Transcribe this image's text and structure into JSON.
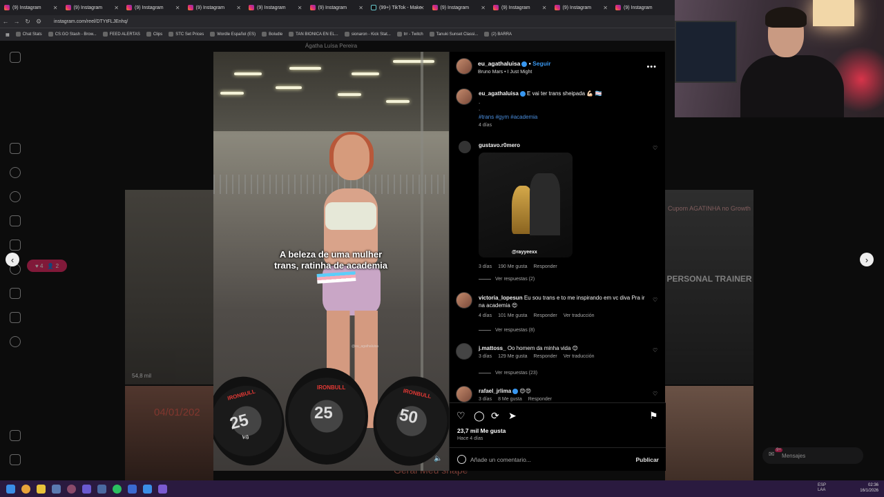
{
  "browser": {
    "tabs": [
      {
        "label": "(9) Instagram",
        "kind": "ig"
      },
      {
        "label": "(9) Instagram",
        "kind": "ig"
      },
      {
        "label": "(9) Instagram",
        "kind": "ig"
      },
      {
        "label": "(9) Instagram",
        "kind": "ig"
      },
      {
        "label": "(9) Instagram",
        "kind": "ig"
      },
      {
        "label": "(9) Instagram",
        "kind": "ig"
      },
      {
        "label": "(99+) TikTok - Make",
        "kind": "tt"
      },
      {
        "label": "(9) Instagram",
        "kind": "ig"
      },
      {
        "label": "(9) Instagram",
        "kind": "ig"
      },
      {
        "label": "(9) Instagram",
        "kind": "ig"
      },
      {
        "label": "(9) Instagram",
        "kind": "ig"
      }
    ],
    "url": "instagram.com/reel/DTYtFLJEnhq/",
    "bookmarks": [
      "Chat Stats",
      "CS:GO Stash - Brow...",
      "FEED ALERTAS",
      "Clips",
      "STC Set Prices",
      "Wordle Español (ES)",
      "Boludle",
      "TAN BIONICA EN EL...",
      "sionaron - Kick Stat...",
      "trr - Twitch",
      "Tanuki Sunset Classi...",
      "(2) BARRA"
    ]
  },
  "video": {
    "top_label": "Ágatha Luísa Pereira",
    "caption_line1": "A beleza de uma mulher",
    "caption_line2": "trans, ratinha de academia",
    "watermark": "@eu_agathaluisa",
    "weight_brand": "IRONBULL",
    "weight_1": "25",
    "weight_2": "25",
    "weight_3": "50",
    "weight_unit": "kg"
  },
  "background": {
    "views": "54,8 mil",
    "date_tag": "04/01/202",
    "coupon": "Cupom AGATINHA no Growth",
    "shirt": "PERSONAL TRAINER",
    "bottom_text": "Gerai Meu shape",
    "notif_likes": "4",
    "notif_follows": "2"
  },
  "post": {
    "username": "eu_agathaluisa",
    "follow_label": "Seguir",
    "song": "Bruno Mars • I Just Might",
    "caption_user": "eu_agathaluisa",
    "caption_text": "E vai ter trans sheipada 💪🏻 🏳️‍⚧️",
    "caption_dots": ".",
    "hashtags": "#trans #gym #academia",
    "caption_age": "4 días",
    "likes": "23,7 mil Me gusta",
    "posted": "Hace 4 días",
    "add_comment_placeholder": "Añade un comentario...",
    "publish_label": "Publicar"
  },
  "comments": [
    {
      "user": "gustavo.r0mero",
      "text": "",
      "age": "3 días",
      "likes": "190 Me gusta",
      "reply": "Responder",
      "translate": "",
      "replies": "Ver respuestas (2)",
      "gif_tag": "@rayyeexx"
    },
    {
      "user": "victoria_lopesun",
      "text": "Eu sou trans e to me inspirando em vc diva Pra ir na academia 😍",
      "age": "4 días",
      "likes": "101 Me gusta",
      "reply": "Responder",
      "translate": "Ver traducción",
      "replies": "Ver respuestas (8)"
    },
    {
      "user": "j.mattoss_",
      "text": "Oo homem da minha vida 😊",
      "age": "3 días",
      "likes": "129 Me gusta",
      "reply": "Responder",
      "translate": "Ver traducción",
      "replies": "Ver respuestas (23)"
    },
    {
      "user": "rafael_jrlima",
      "text": "😍😍",
      "age": "3 días",
      "likes": "8 Me gusta",
      "reply": "Responder",
      "translate": "",
      "replies": ""
    }
  ],
  "messages_label": "Mensajes",
  "messages_badge": "9+",
  "taskbar": {
    "lang": "ESP",
    "lang2": "LAA",
    "time": "02:36",
    "date": "16/1/2026"
  }
}
